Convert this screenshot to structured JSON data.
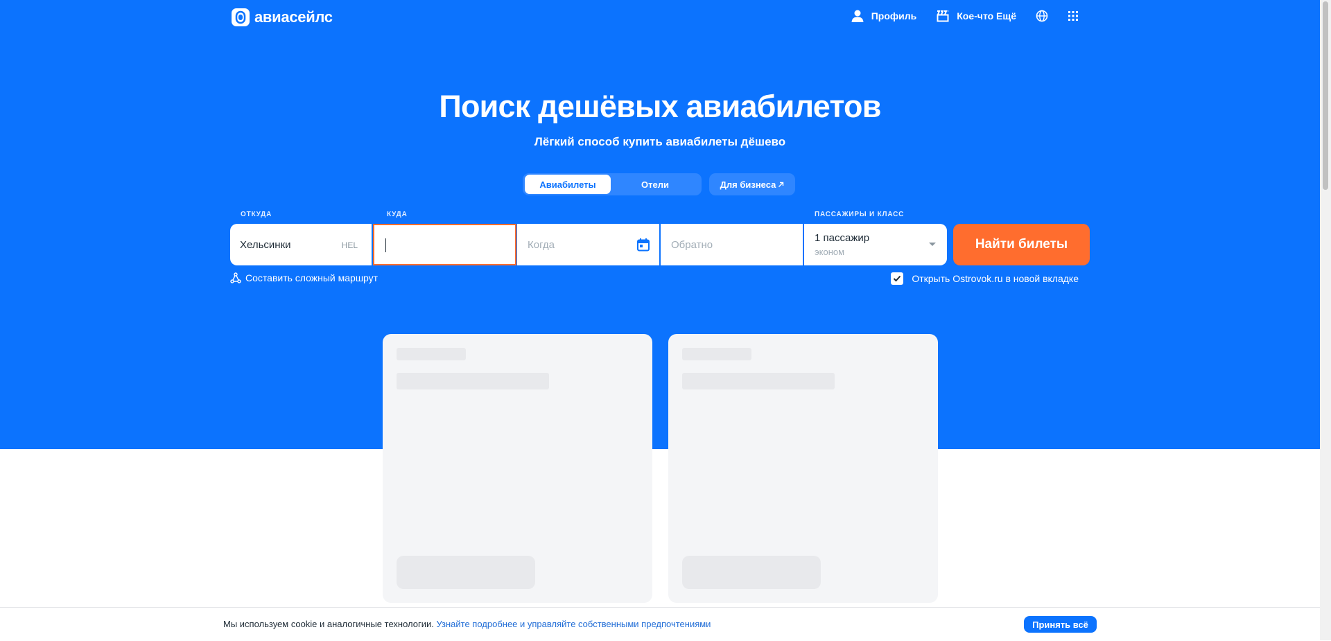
{
  "header": {
    "logo_text": "авиасейлс",
    "nav": {
      "profile_label": "Профиль",
      "more_label": "Кое-что Ещё",
      "language_icon": "globe-icon",
      "apps_icon": "grid-icon"
    }
  },
  "hero": {
    "title": "Поиск дешёвых авиабилетов",
    "subtitle": "Лёгкий способ купить авиабилеты дёшево"
  },
  "tabs": {
    "items": [
      {
        "label": "Авиабилеты",
        "active": true
      },
      {
        "label": "Отели",
        "active": false
      }
    ],
    "business_label": "Для бизнеса"
  },
  "search": {
    "from_label": "ОТКУДА",
    "to_label": "КУДА",
    "passengers_label": "ПАССАЖИРЫ И КЛАСС",
    "from_value": "Хельсинки",
    "from_code": "HEL",
    "to_value": "",
    "when_placeholder": "Когда",
    "return_placeholder": "Обратно",
    "passengers_value": "1 пассажир",
    "class_value": "эконом",
    "submit_label": "Найти билеты",
    "complex_route_label": "Составить сложный маршрут",
    "open_ostrovok_label": "Открыть Ostrovok.ru в новой вкладке",
    "open_ostrovok_checked": true
  },
  "cookie": {
    "text": "Мы используем cookie и аналогичные технологии.",
    "link": "Узнайте подробнее и управляйте собственными предпочтениями",
    "accept_label": "Принять всё"
  },
  "colors": {
    "brand_blue": "#0c73fe",
    "accent_orange": "#ff6d2e",
    "link_blue": "#1f6cd6"
  }
}
